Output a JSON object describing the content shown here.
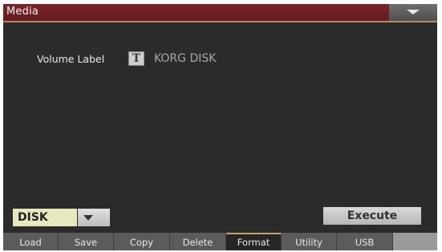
{
  "header": {
    "title": "Media"
  },
  "volume": {
    "label": "Volume Label",
    "type_icon": "T",
    "value": "KORG DISK"
  },
  "device": {
    "selected": "DISK"
  },
  "execute_label": "Execute",
  "tabs": [
    {
      "label": "Load"
    },
    {
      "label": "Save"
    },
    {
      "label": "Copy"
    },
    {
      "label": "Delete"
    },
    {
      "label": "Format"
    },
    {
      "label": "Utility"
    },
    {
      "label": "USB"
    }
  ],
  "active_tab": "Format"
}
